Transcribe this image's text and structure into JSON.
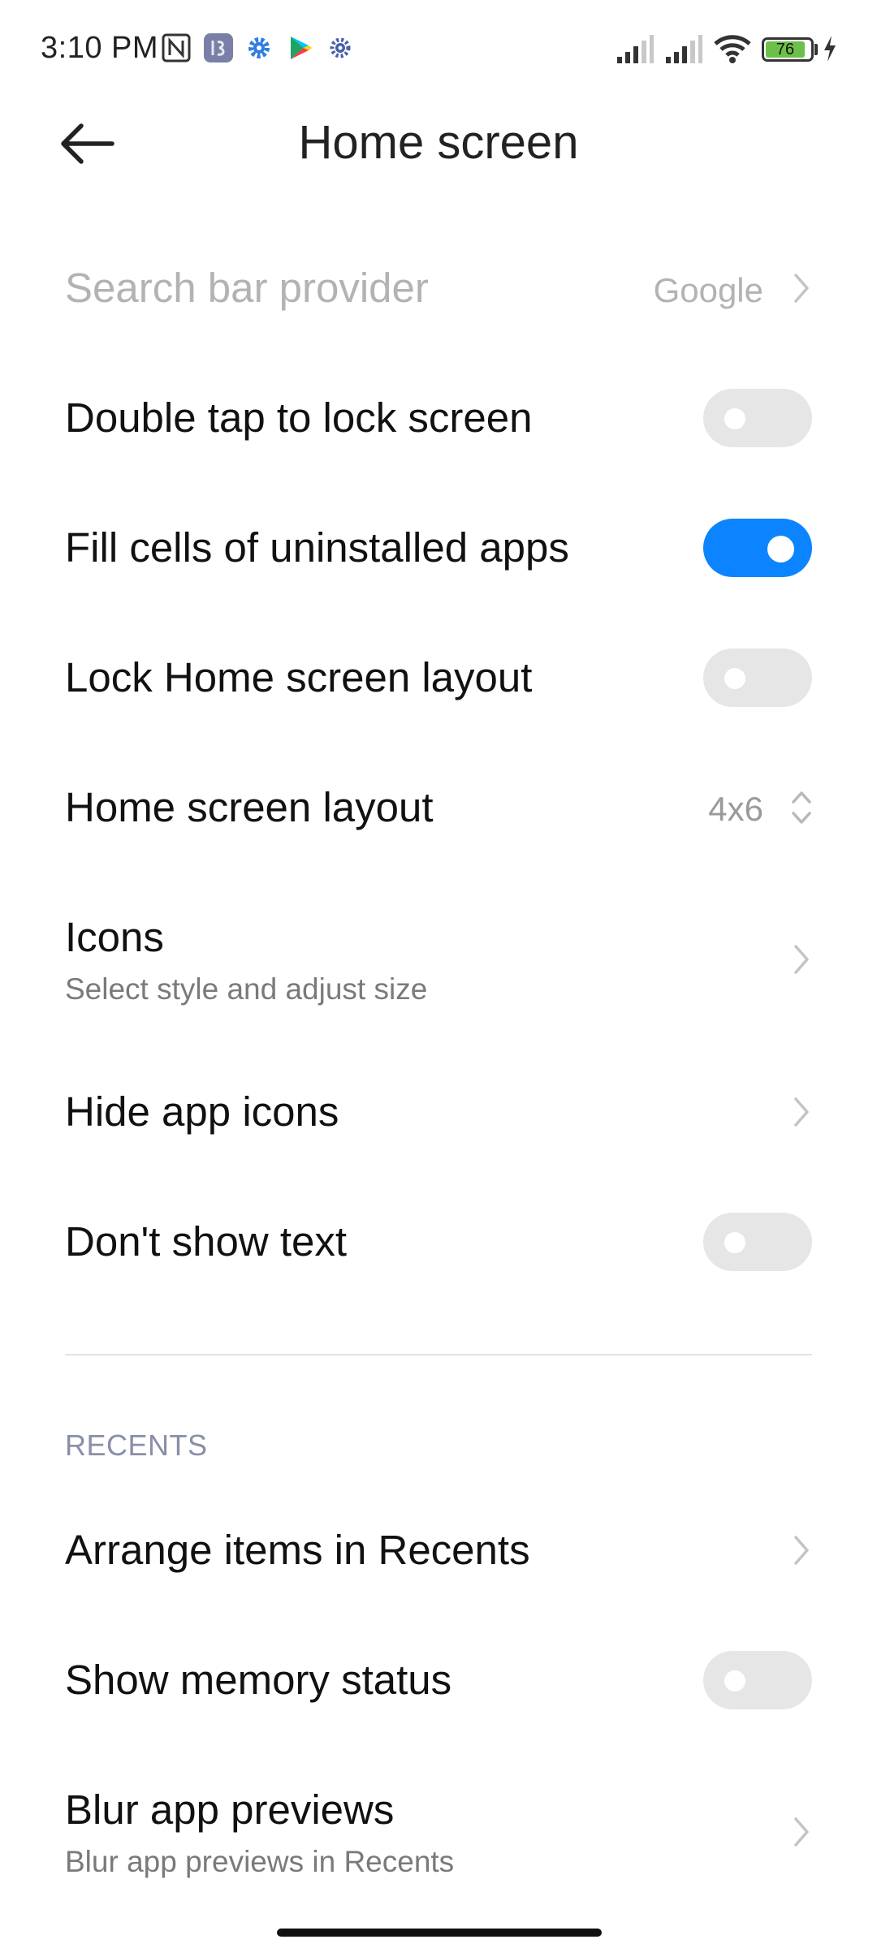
{
  "status_bar": {
    "time": "3:10 PM",
    "notification_icons": [
      "nfc-icon",
      "app-13-icon",
      "settings-gear-icon",
      "play-store-icon",
      "settings-gear-small-icon"
    ],
    "battery_level": "76",
    "battery_color": "#6cc04a"
  },
  "header": {
    "title": "Home screen"
  },
  "settings": {
    "search_bar_provider": {
      "label": "Search bar provider",
      "value": "Google",
      "enabled": false
    },
    "double_tap_lock": {
      "label": "Double tap to lock screen",
      "on": false
    },
    "fill_cells": {
      "label": "Fill cells of uninstalled apps",
      "on": true
    },
    "lock_layout": {
      "label": "Lock Home screen layout",
      "on": false
    },
    "home_layout": {
      "label": "Home screen layout",
      "value": "4x6"
    },
    "icons": {
      "label": "Icons",
      "subtitle": "Select style and adjust size"
    },
    "hide_app_icons": {
      "label": "Hide app icons"
    },
    "dont_show_text": {
      "label": "Don't show text",
      "on": false
    }
  },
  "recents": {
    "section_title": "RECENTS",
    "arrange_items": {
      "label": "Arrange items in Recents"
    },
    "memory_status": {
      "label": "Show memory status",
      "on": false
    },
    "blur_previews": {
      "label": "Blur app previews",
      "subtitle": "Blur app previews in Recents"
    }
  },
  "colors": {
    "accent": "#0d84ff",
    "toggle_off": "#e6e6e6",
    "section_header": "#8a8fa8"
  }
}
